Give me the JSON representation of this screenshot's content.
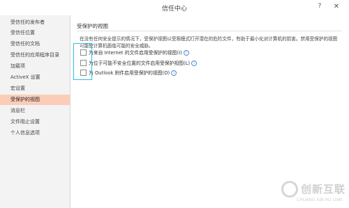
{
  "window": {
    "title": "信任中心",
    "help": "?",
    "close": "✕"
  },
  "sidebar": {
    "items": [
      {
        "label": "受信任的发布者"
      },
      {
        "label": "受信任位置"
      },
      {
        "label": "受信任的文档"
      },
      {
        "label": "受信任的应用程序目录"
      },
      {
        "label": "加载项"
      },
      {
        "label": "ActiveX 设置"
      },
      {
        "label": "宏设置"
      },
      {
        "label": "受保护的视图"
      },
      {
        "label": "消息栏"
      },
      {
        "label": "文件阻止设置"
      },
      {
        "label": "个人信息选项"
      }
    ],
    "active_index": 7
  },
  "main": {
    "section_title": "受保护的视图",
    "description": "在没有任何安全提示的情况下，受保护视图以受限模式打开潜在的危险文件，有助于最小化对计算机的损害。禁用受保护的视图可能使计算机面临可能的安全威胁。",
    "options": [
      {
        "label": "为来自 Internet 的文件启用受保护的视图(I)",
        "checked": false,
        "has_info": true
      },
      {
        "label": "为位于可能不安全位置的文件启用受保护视图(L)",
        "checked": false,
        "has_info": true
      },
      {
        "label": "为 Outlook 附件启用受保护的视图(O)",
        "checked": false,
        "has_info": true
      }
    ]
  },
  "watermark": {
    "brand": "创新互联",
    "sub": "CHUANG XIN HU LIAN"
  },
  "colors": {
    "active_nav": "#fbcdb9",
    "highlight": "#28c0e6",
    "info": "#4a88d6"
  }
}
